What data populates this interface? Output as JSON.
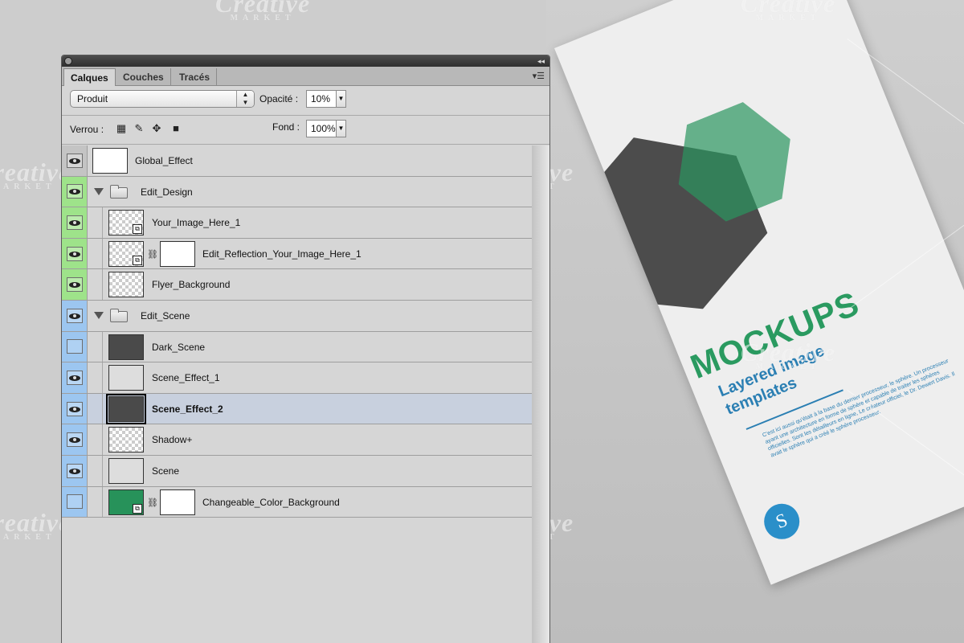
{
  "watermark": {
    "word": "Creative",
    "sub": "MARKET"
  },
  "flyer": {
    "title": "MOCKUPS",
    "subtitle_1": "Layered image",
    "subtitle_2": "templates",
    "logo_letter": "S",
    "body_text": "C'est ici aussi qu'était à la base du dernier processeur, le sphère. Un processeur ayant une architecture en forme de sphère et capable de traiter les sphères officielles. Sont les détailleurs en ligne, Le créateur officiel, le Dr. Dewert Davis. Il avait le sphère qui a créé le sphère processeur."
  },
  "panel": {
    "tabs": [
      "Calques",
      "Couches",
      "Tracés"
    ],
    "active_tab": "Calques",
    "blend_mode": "Produit",
    "opacity_label": "Opacité :",
    "opacity_value": "10%",
    "lock_label": "Verrou :",
    "fill_label": "Fond :",
    "fill_value": "100%",
    "layers": [
      {
        "name": "Global_Effect",
        "visible": true,
        "color": "gray",
        "type": "layer"
      },
      {
        "name": "Edit_Design",
        "visible": true,
        "color": "green",
        "type": "group"
      },
      {
        "name": "Your_Image_Here_1",
        "visible": true,
        "color": "green",
        "type": "smart"
      },
      {
        "name": "Edit_Reflection_Your_Image_Here_1",
        "visible": true,
        "color": "green",
        "type": "smart-mask"
      },
      {
        "name": "Flyer_Background",
        "visible": true,
        "color": "green",
        "type": "layer"
      },
      {
        "name": "Edit_Scene",
        "visible": true,
        "color": "blue",
        "type": "group"
      },
      {
        "name": "Dark_Scene",
        "visible": false,
        "color": "blue",
        "type": "layer"
      },
      {
        "name": "Scene_Effect_1",
        "visible": true,
        "color": "blue",
        "type": "layer"
      },
      {
        "name": "Scene_Effect_2",
        "visible": true,
        "color": "blue",
        "type": "layer",
        "selected": true
      },
      {
        "name": "Shadow+",
        "visible": true,
        "color": "blue",
        "type": "layer"
      },
      {
        "name": "Scene",
        "visible": true,
        "color": "blue",
        "type": "layer"
      },
      {
        "name": "Changeable_Color_Background",
        "visible": false,
        "color": "blue",
        "type": "smart-mask"
      }
    ]
  }
}
